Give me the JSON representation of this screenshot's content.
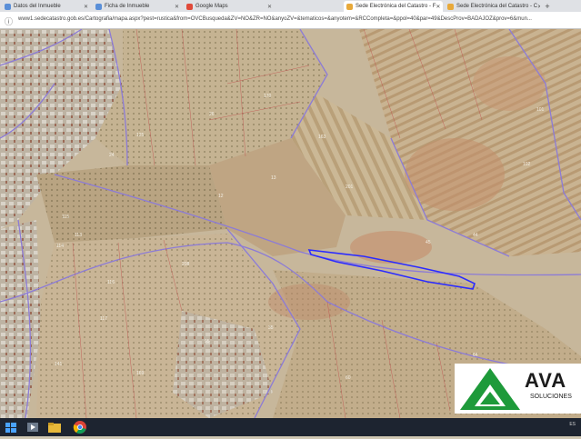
{
  "browser": {
    "tabs": [
      {
        "label": "Datos del Inmueble",
        "active": false,
        "icon": "page-icon"
      },
      {
        "label": "Ficha de Inmueble",
        "active": false,
        "icon": "page-icon"
      },
      {
        "label": "Google Maps",
        "active": false,
        "icon": "maps-icon"
      },
      {
        "label": "Sede Electrónica del Catastro - F",
        "active": true,
        "icon": "catastro-icon"
      },
      {
        "label": "Sede Electrónica del Catastro - C",
        "active": false,
        "icon": "catastro-icon"
      }
    ],
    "new_tab_label": "+",
    "url": "www1.sedecatastro.gob.es/Cartografia/mapa.aspx?pest=rustica&from=OVCBusqueda&ZV=NO&ZR=NO&anyoZV=&tematicos=&anyotem=&RCCompleta=&ppol=40&par=49&DescProv=BADAJOZ&prov=6&mun..."
  },
  "map": {
    "parcel_labels": [
      "115",
      "114",
      "112",
      "113",
      "116",
      "117",
      "125",
      "24",
      "26",
      "170",
      "12",
      "13",
      "163",
      "46",
      "45",
      "44",
      "101",
      "102",
      "103",
      "104",
      "105",
      "106",
      "107",
      "108",
      "109",
      "118",
      "35",
      "201",
      "95",
      "45a",
      "49",
      "61",
      "62",
      "64",
      "60",
      "208",
      "169",
      "141",
      "142",
      "143"
    ],
    "highlight_color": "#2b2bff",
    "boundary_color": "#8c7bd6"
  },
  "logo": {
    "text": "AVA",
    "subtitle": "SOLUCIONES",
    "brand_color": "#1e9a3a"
  },
  "taskbar": {
    "items": [
      "start-icon",
      "explorer-icon",
      "media-icon",
      "folder-icon",
      "chrome-icon"
    ],
    "tray_lang": "ES",
    "tray_line2": ""
  }
}
